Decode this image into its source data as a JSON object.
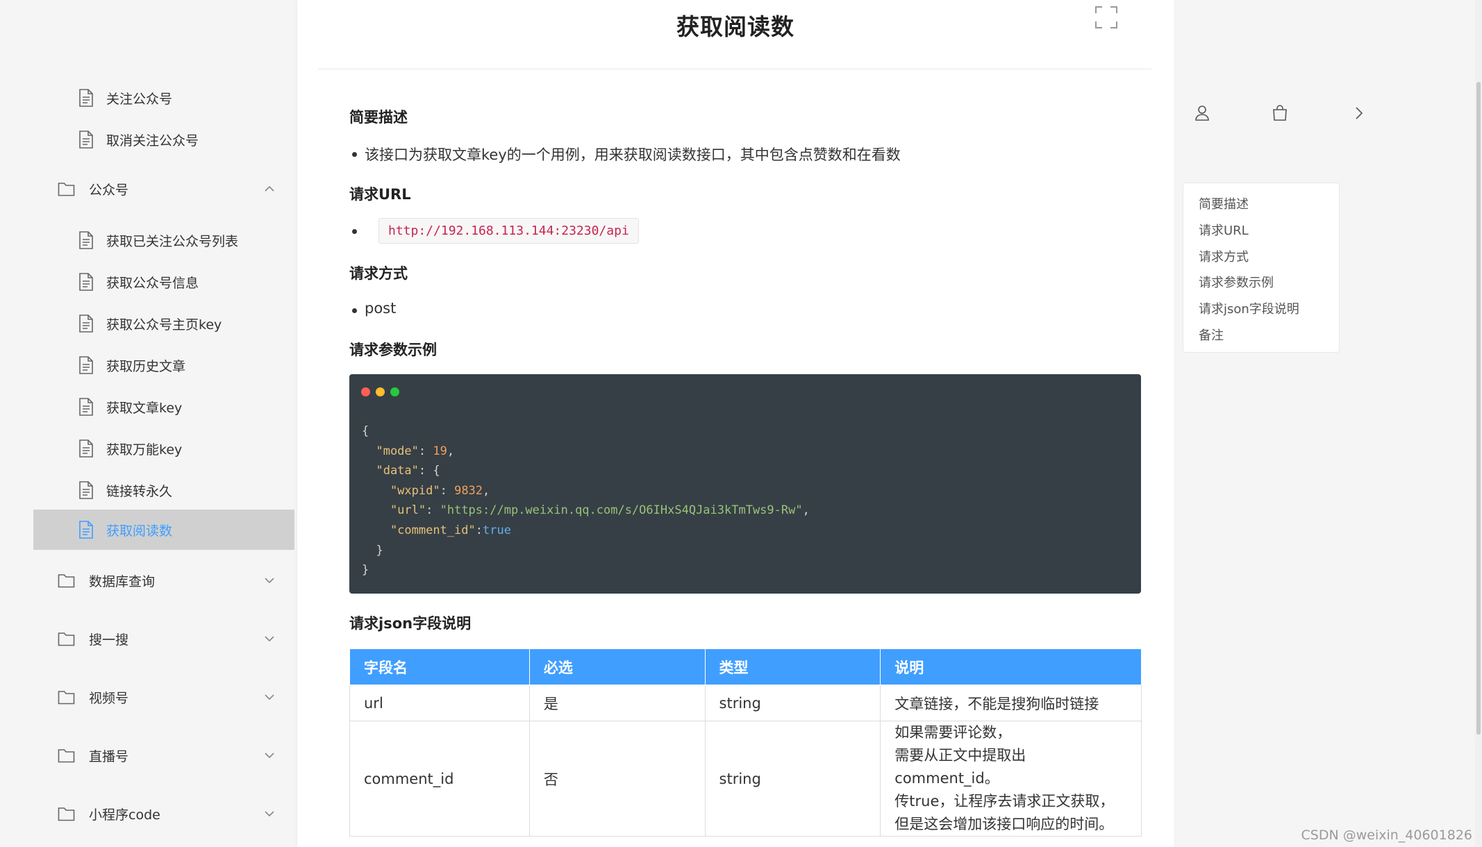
{
  "sidebar": {
    "doc_items": [
      {
        "label": "关注公众号"
      },
      {
        "label": "取消关注公众号"
      },
      {
        "label": "获取已关注公众号列表"
      },
      {
        "label": "获取公众号信息"
      },
      {
        "label": "获取公众号主页key"
      },
      {
        "label": "获取历史文章"
      },
      {
        "label": "获取文章key"
      },
      {
        "label": "获取万能key"
      },
      {
        "label": "链接转永久"
      },
      {
        "label": "获取阅读数",
        "active": true
      }
    ],
    "folders": [
      {
        "label": "公众号",
        "expanded": true
      },
      {
        "label": "数据库查询",
        "expanded": false
      },
      {
        "label": "搜一搜",
        "expanded": false
      },
      {
        "label": "视频号",
        "expanded": false
      },
      {
        "label": "直播号",
        "expanded": false
      },
      {
        "label": "小程序code",
        "expanded": false
      }
    ],
    "active_color": "#409eff"
  },
  "main": {
    "title": "获取阅读数",
    "sections": {
      "desc_heading": "简要描述",
      "desc_text": "该接口为获取文章key的一个用例，用来获取阅读数接口，其中包含点赞数和在看数",
      "url_heading": "请求URL",
      "url": "http://192.168.113.144:23230/api",
      "method_heading": "请求方式",
      "method": "post",
      "params_heading": "请求参数示例",
      "json_heading": "请求json字段说明"
    },
    "code_block": {
      "lines": [
        [
          "{"
        ],
        [
          "  \"mode\"",
          ": ",
          "19",
          ","
        ],
        [
          "  \"data\"",
          ": {"
        ],
        [
          "    \"wxpid\"",
          ": ",
          "9832",
          ","
        ],
        [
          "    \"url\"",
          ": ",
          "\"https://mp.weixin.qq.com/s/O6IHxS4QJai3kTmTws9-Rw\"",
          ","
        ],
        [
          "    \"comment_id\"",
          ":",
          "true"
        ],
        [
          "  }"
        ],
        [
          "}"
        ]
      ]
    },
    "table": {
      "headers": [
        "字段名",
        "必选",
        "类型",
        "说明"
      ],
      "rows": [
        {
          "field": "url",
          "required": "是",
          "type": "string",
          "desc_lines": [
            "文章链接，不能是搜狗临时链接"
          ]
        },
        {
          "field": "comment_id",
          "required": "否",
          "type": "string",
          "desc_lines": [
            "如果需要评论数，",
            "需要从正文中提取出comment_id。",
            "传true，让程序去请求正文获取，",
            "但是这会增加该接口响应的时间。"
          ]
        }
      ],
      "header_color": "#409eff"
    }
  },
  "right_panel": {
    "toc": [
      "简要描述",
      "请求URL",
      "请求方式",
      "请求参数示例",
      "请求json字段说明",
      "备注"
    ]
  },
  "watermark": "CSDN @weixin_40601826",
  "icons": {
    "doc": "document-icon",
    "folder": "folder-icon",
    "fullscreen": "fullscreen-icon",
    "user": "user-icon",
    "bag": "bag-icon",
    "chevron_right": "chevron-right-icon"
  }
}
